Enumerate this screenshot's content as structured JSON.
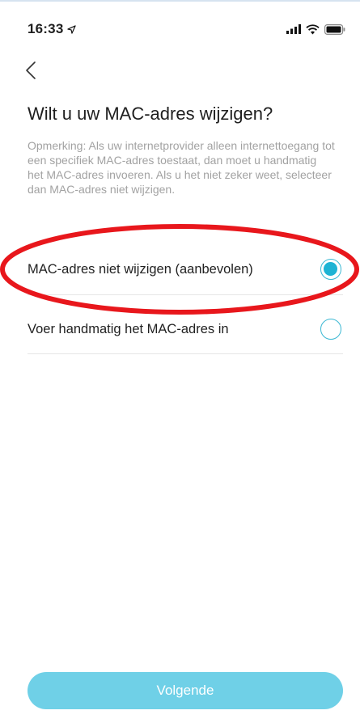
{
  "status_bar": {
    "time": "16:33",
    "location_icon": "location-arrow-icon",
    "signal_icon": "cellular-signal-icon",
    "wifi_icon": "wifi-icon",
    "battery_icon": "battery-icon"
  },
  "nav": {
    "back_icon": "chevron-left-icon"
  },
  "page": {
    "title": "Wilt u uw MAC-adres wijzigen?",
    "note": "Opmerking: Als uw internetprovider alleen internettoegang tot een specifiek MAC-adres toestaat, dan moet u handmatig het MAC-adres invoeren. Als u het niet zeker weet, selecteer dan MAC-adres niet wijzigen."
  },
  "options": [
    {
      "label": "MAC-adres niet wijzigen (aanbevolen)",
      "selected": true
    },
    {
      "label": "Voer handmatig het MAC-adres in",
      "selected": false
    }
  ],
  "annotation": {
    "color": "#e8171c"
  },
  "footer": {
    "next_label": "Volgende"
  },
  "colors": {
    "accent": "#1eb3d4",
    "button": "#6fd0e7",
    "note_text": "#a2a2a2"
  }
}
